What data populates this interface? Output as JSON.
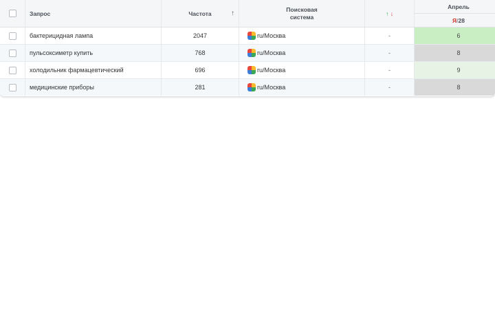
{
  "header": {
    "query": "Запрос",
    "frequency": "Частота",
    "sort_arrow": "↑",
    "search_engine_line1": "Поисковая",
    "search_engine_line2": "система",
    "change_up": "↑",
    "change_down": "↓",
    "month": "Апрель",
    "engine_short": "Я",
    "slash": "/",
    "depth": "28"
  },
  "rows": [
    {
      "query": "бактерицидная лампа",
      "frequency": "2047",
      "search_engine": "ru/Москва",
      "change": "-",
      "position": "6",
      "position_color": "#c9eec4"
    },
    {
      "query": "пульсоксиметр купить",
      "frequency": "768",
      "search_engine": "ru/Москва",
      "change": "-",
      "position": "8",
      "position_color": "#d9d9d9"
    },
    {
      "query": "холодильник фармацевтический",
      "frequency": "696",
      "search_engine": "ru/Москва",
      "change": "-",
      "position": "9",
      "position_color": "#e7f3e4"
    },
    {
      "query": "медицинские приборы",
      "frequency": "281",
      "search_engine": "ru/Москва",
      "change": "-",
      "position": "8",
      "position_color": "#d9d9d9"
    }
  ],
  "icons": {
    "checkbox": "checkbox-icon",
    "search_engine_logo": "google-yandex-logo-icon"
  }
}
